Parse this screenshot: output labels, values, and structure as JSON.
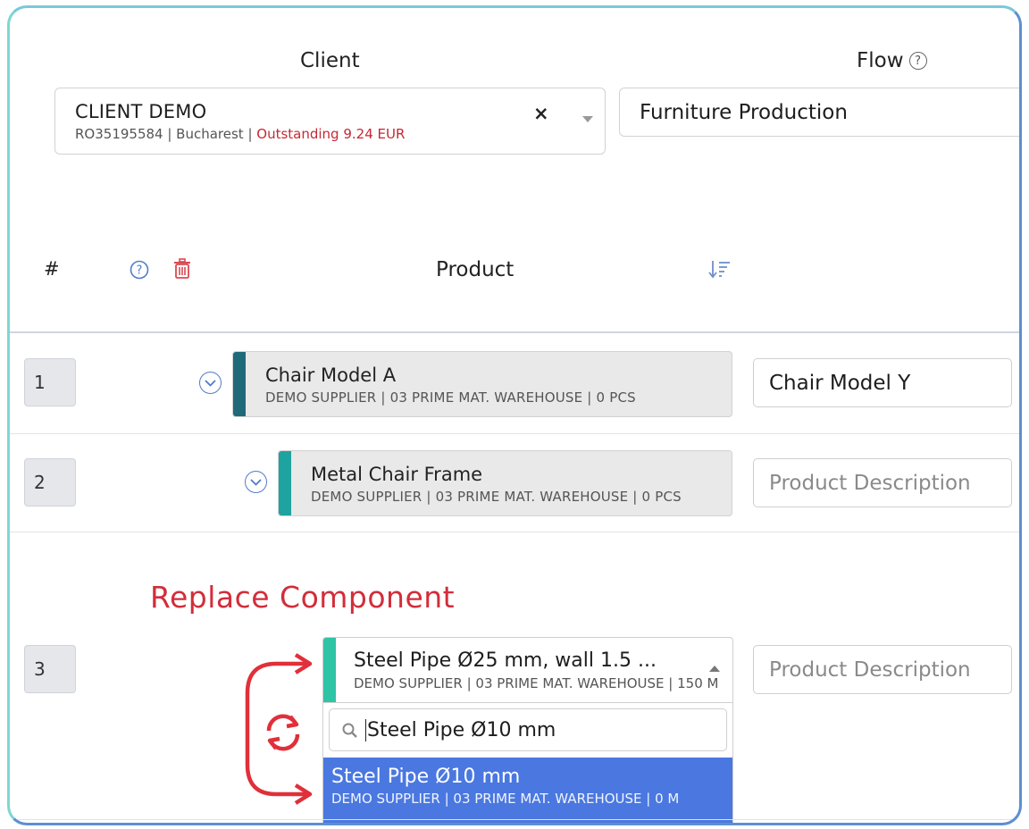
{
  "client": {
    "label": "Client",
    "name": "CLIENT DEMO",
    "details": "RO35195584 | Bucharest | ",
    "outstanding": "Outstanding 9.24 EUR",
    "clear": "×"
  },
  "flow": {
    "label": "Flow",
    "value": "Furniture Production"
  },
  "table": {
    "col_number": "#",
    "col_product": "Product"
  },
  "rows": [
    {
      "number": "1",
      "product_name": "Chair Model A",
      "product_meta": "DEMO SUPPLIER | 03 PRIME MAT. WAREHOUSE | 0 PCS",
      "description_value": "Chair Model Y"
    },
    {
      "number": "2",
      "product_name": "Metal Chair Frame",
      "product_meta": "DEMO SUPPLIER | 03 PRIME MAT. WAREHOUSE | 0 PCS",
      "description_placeholder": "Product Description"
    },
    {
      "number": "3",
      "product_name": "Steel Pipe Ø25 mm, wall 1.5 ...",
      "product_meta": "DEMO SUPPLIER | 03 PRIME MAT. WAREHOUSE | 150 M",
      "description_placeholder": "Product Description"
    }
  ],
  "annotation": {
    "replace_label": "Replace Component"
  },
  "dropdown": {
    "search_value": "Steel Pipe Ø10 mm",
    "option_name": "Steel Pipe Ø10 mm",
    "option_meta": "DEMO SUPPLIER | 03 PRIME MAT. WAREHOUSE | 0 M"
  },
  "colors": {
    "stripe_row1": "#1f6a78",
    "stripe_row2": "#1fa3a0",
    "stripe_row3": "#2ec4a5",
    "accent_red": "#d22d3a",
    "option_highlight": "#4a78e0"
  }
}
